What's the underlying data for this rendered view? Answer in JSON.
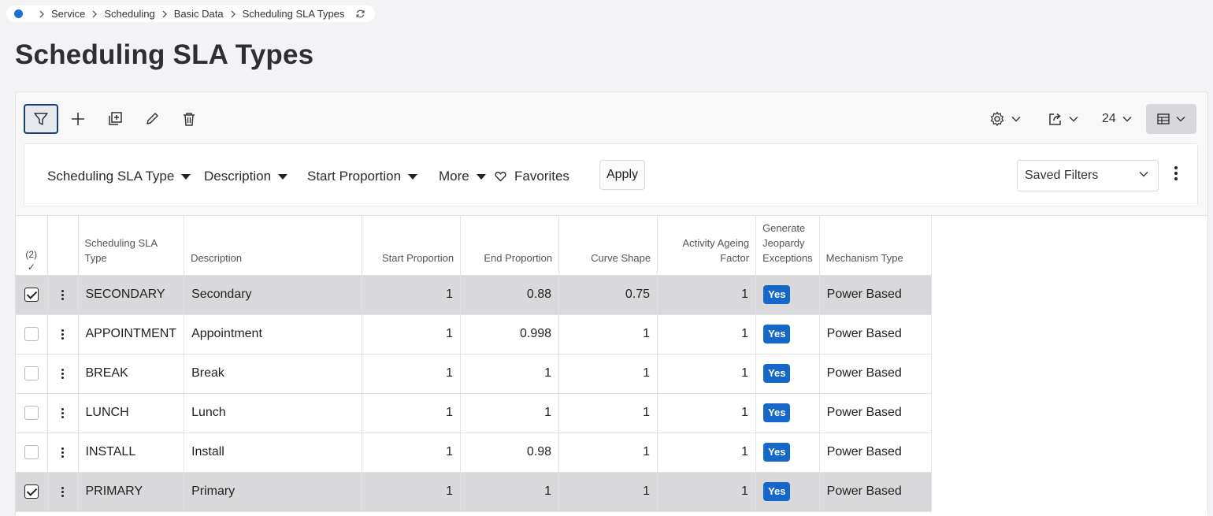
{
  "breadcrumb": {
    "items": [
      "Service",
      "Scheduling",
      "Basic Data",
      "Scheduling SLA Types"
    ]
  },
  "page": {
    "title": "Scheduling SLA Types"
  },
  "toolbar": {
    "page_size": "24"
  },
  "filters": {
    "scheduling_sla_type": "Scheduling SLA Type",
    "description": "Description",
    "start_proportion": "Start Proportion",
    "more": "More",
    "favorites": "Favorites",
    "apply": "Apply",
    "saved_filters": "Saved Filters"
  },
  "table": {
    "selected_count": "(2)",
    "selected_check": "✓",
    "headers": {
      "type": "Scheduling SLA Type",
      "description": "Description",
      "start": "Start Proportion",
      "end": "End Proportion",
      "curve": "Curve Shape",
      "ageing": "Activity Ageing Factor",
      "jeopardy": "Generate Jeopardy Exceptions",
      "mechanism": "Mechanism Type"
    },
    "rows": [
      {
        "checked": true,
        "type": "SECONDARY",
        "description": "Secondary",
        "start": "1",
        "end": "0.88",
        "curve": "0.75",
        "ageing": "1",
        "jeopardy": "Yes",
        "mechanism": "Power Based"
      },
      {
        "checked": false,
        "type": "APPOINTMENT",
        "description": "Appointment",
        "start": "1",
        "end": "0.998",
        "curve": "1",
        "ageing": "1",
        "jeopardy": "Yes",
        "mechanism": "Power Based"
      },
      {
        "checked": false,
        "type": "BREAK",
        "description": "Break",
        "start": "1",
        "end": "1",
        "curve": "1",
        "ageing": "1",
        "jeopardy": "Yes",
        "mechanism": "Power Based"
      },
      {
        "checked": false,
        "type": "LUNCH",
        "description": "Lunch",
        "start": "1",
        "end": "1",
        "curve": "1",
        "ageing": "1",
        "jeopardy": "Yes",
        "mechanism": "Power Based"
      },
      {
        "checked": false,
        "type": "INSTALL",
        "description": "Install",
        "start": "1",
        "end": "0.98",
        "curve": "1",
        "ageing": "1",
        "jeopardy": "Yes",
        "mechanism": "Power Based"
      },
      {
        "checked": true,
        "type": "PRIMARY",
        "description": "Primary",
        "start": "1",
        "end": "1",
        "curve": "1",
        "ageing": "1",
        "jeopardy": "Yes",
        "mechanism": "Power Based"
      }
    ]
  },
  "colors": {
    "accent": "#1668c8",
    "selected_row": "#d9d9dc"
  }
}
